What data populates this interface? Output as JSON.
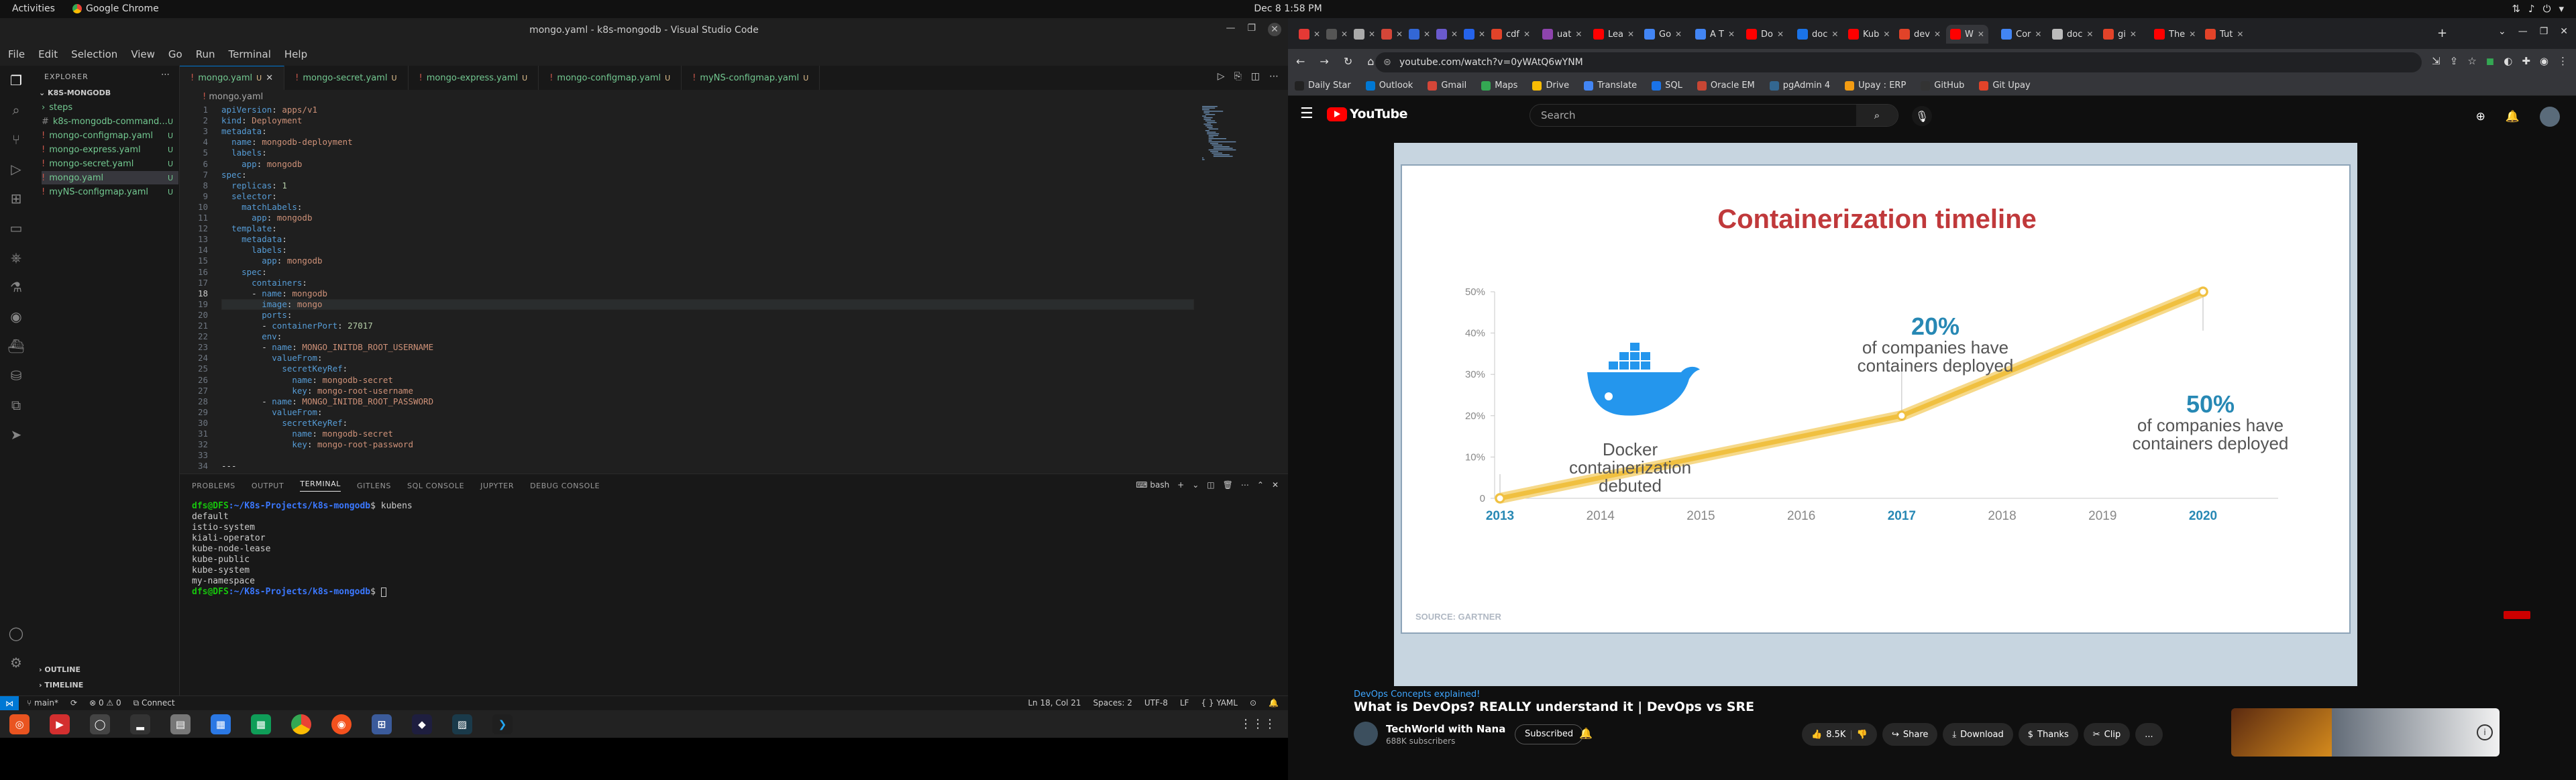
{
  "system": {
    "activities": "Activities",
    "active_app": "Google Chrome",
    "clock": "Dec 8  1:58 PM"
  },
  "vscode": {
    "title": "mongo.yaml - k8s-mongodb - Visual Studio Code",
    "menu": [
      "File",
      "Edit",
      "Selection",
      "View",
      "Go",
      "Run",
      "Terminal",
      "Help"
    ],
    "explorer_label": "EXPLORER",
    "project": "K8S-MONGODB",
    "files": [
      {
        "name": "steps",
        "status": ""
      },
      {
        "name": "k8s-mongodb-command...",
        "status": "U"
      },
      {
        "name": "mongo-configmap.yaml",
        "status": "U"
      },
      {
        "name": "mongo-express.yaml",
        "status": "U"
      },
      {
        "name": "mongo-secret.yaml",
        "status": "U"
      },
      {
        "name": "mongo.yaml",
        "status": "U"
      },
      {
        "name": "myNS-configmap.yaml",
        "status": "U"
      }
    ],
    "outline": "OUTLINE",
    "timeline": "TIMELINE",
    "tabs": [
      {
        "label": "mongo.yaml",
        "mark": "U"
      },
      {
        "label": "mongo-secret.yaml",
        "mark": "U"
      },
      {
        "label": "mongo-express.yaml",
        "mark": "U"
      },
      {
        "label": "mongo-configmap.yaml",
        "mark": "U"
      },
      {
        "label": "myNS-configmap.yaml",
        "mark": "U"
      }
    ],
    "breadcrumb": "mongo.yaml",
    "code": [
      "apiVersion: apps/v1",
      "kind: Deployment",
      "metadata:",
      "  name: mongodb-deployment",
      "  labels:",
      "    app: mongodb",
      "spec:",
      "  replicas: 1",
      "  selector:",
      "    matchLabels:",
      "      app: mongodb",
      "  template:",
      "    metadata:",
      "      labels:",
      "        app: mongodb",
      "    spec:",
      "      containers:",
      "      - name: mongodb",
      "        image: mongo",
      "        ports:",
      "        - containerPort: 27017",
      "        env:",
      "        - name: MONGO_INITDB_ROOT_USERNAME",
      "          valueFrom:",
      "            secretKeyRef:",
      "              name: mongodb-secret",
      "              key: mongo-root-username",
      "        - name: MONGO_INITDB_ROOT_PASSWORD",
      "          valueFrom:",
      "            secretKeyRef:",
      "              name: mongodb-secret",
      "              key: mongo-root-password",
      "",
      "---"
    ],
    "panel_tabs": [
      "PROBLEMS",
      "OUTPUT",
      "TERMINAL",
      "GITLENS",
      "SQL CONSOLE",
      "JUPYTER",
      "DEBUG CONSOLE"
    ],
    "terminal_shell": "bash",
    "terminal": {
      "prompt_user": "dfs@DFS",
      "prompt_path": ":~/K8s-Projects/k8s-mongodb",
      "command": "$ kubens",
      "output": [
        "default",
        "istio-system",
        "kiali-operator",
        "kube-node-lease",
        "kube-public",
        "kube-system",
        "my-namespace"
      ],
      "final_prompt_tail": "$ "
    },
    "status": {
      "branch": "main*",
      "problems": "0 ⚠ 0",
      "connect": "Connect",
      "position": "Ln 18, Col 21",
      "spaces": "Spaces: 2",
      "encoding": "UTF-8",
      "eol": "LF",
      "language": "YAML"
    }
  },
  "chrome": {
    "tabs": [
      {
        "label": "",
        "color": "#e53935"
      },
      {
        "label": "",
        "color": "#555"
      },
      {
        "label": "",
        "color": "#aaa"
      },
      {
        "label": "",
        "color": "#d44638"
      },
      {
        "label": "",
        "color": "#3367d6"
      },
      {
        "label": "",
        "color": "#6a5acd"
      },
      {
        "label": "",
        "color": "#2563eb"
      },
      {
        "label": "cdf",
        "color": "#e24329"
      },
      {
        "label": "uat",
        "color": "#8e44ad"
      },
      {
        "label": "Lea",
        "color": "#ff0000"
      },
      {
        "label": "Go",
        "color": "#4285f4"
      },
      {
        "label": "A T",
        "color": "#4285f4"
      },
      {
        "label": "Do",
        "color": "#ff0000"
      },
      {
        "label": "doc",
        "color": "#1a73e8"
      },
      {
        "label": "Kub",
        "color": "#ff0000"
      },
      {
        "label": "dev",
        "color": "#e24329"
      },
      {
        "label": "W",
        "color": "#ff0000"
      },
      {
        "label": "Cor",
        "color": "#4285f4"
      },
      {
        "label": "doc",
        "color": "#bbb"
      },
      {
        "label": "gi",
        "color": "#e24329"
      },
      {
        "label": "The",
        "color": "#ff0000"
      },
      {
        "label": "Tut",
        "color": "#e24329"
      }
    ],
    "url": "youtube.com/watch?v=0yWAtQ6wYNM",
    "bookmarks": [
      {
        "label": "Daily Star",
        "color": "#222"
      },
      {
        "label": "Outlook",
        "color": "#0078d4"
      },
      {
        "label": "Gmail",
        "color": "#d44638"
      },
      {
        "label": "Maps",
        "color": "#34a853"
      },
      {
        "label": "Drive",
        "color": "#fbbc04"
      },
      {
        "label": "Translate",
        "color": "#4285f4"
      },
      {
        "label": "SQL",
        "color": "#1a73e8"
      },
      {
        "label": "Oracle EM",
        "color": "#c74634"
      },
      {
        "label": "pgAdmin 4",
        "color": "#336791"
      },
      {
        "label": "Upay : ERP",
        "color": "#f39c12"
      },
      {
        "label": "GitHub",
        "color": "#333"
      },
      {
        "label": "Git Upay",
        "color": "#e24329"
      }
    ]
  },
  "youtube": {
    "search_placeholder": "Search",
    "slide": {
      "title": "Containerization timeline",
      "source": "SOURCE: GARTNER",
      "ann_docker": "Docker containerization debuted",
      "ann_20_big": "20%",
      "ann_20_txt": "of companies have containers deployed",
      "ann_50_big": "50%",
      "ann_50_txt": "of companies have containers deployed"
    },
    "video": {
      "topic": "DevOps Concepts explained!",
      "title": "What is DevOps? REALLY understand it | DevOps vs SRE",
      "channel": "TechWorld with Nana",
      "subscribers": "688K subscribers",
      "subscribe": "Subscribed",
      "likes": "8.5K",
      "share": "Share",
      "download": "Download",
      "thanks": "Thanks",
      "clip": "Clip",
      "more": "..."
    }
  },
  "chart_data": {
    "type": "line",
    "title": "Containerization timeline",
    "x": [
      2013,
      2014,
      2015,
      2016,
      2017,
      2018,
      2019,
      2020
    ],
    "series": [
      {
        "values": [
          0,
          null,
          null,
          null,
          20,
          null,
          null,
          50
        ]
      }
    ],
    "ylim": [
      0,
      50
    ],
    "yticks": [
      "0",
      "10%",
      "20%",
      "30%",
      "40%",
      "50%"
    ],
    "xlabel": "",
    "ylabel": "",
    "grid": true,
    "highlight_years": [
      2013,
      2017,
      2020
    ],
    "line_color": "#f0c040",
    "highlight_color": "#2788b4"
  }
}
